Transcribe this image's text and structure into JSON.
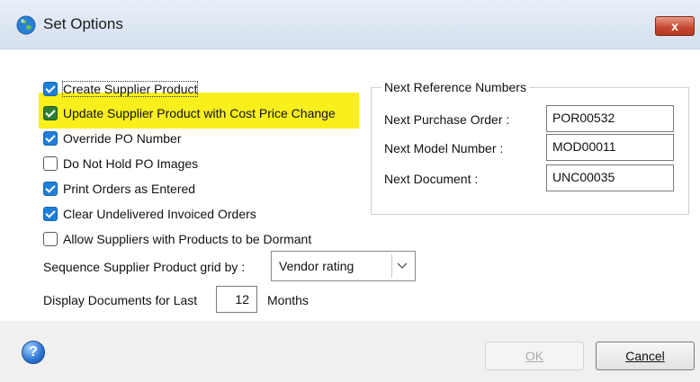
{
  "window": {
    "title": "Set Options",
    "close_label": "x"
  },
  "options": [
    {
      "label": "Create Supplier Product",
      "checked": true
    },
    {
      "label": "Update Supplier Product with Cost Price Change",
      "checked": true
    },
    {
      "label": "Override PO Number",
      "checked": true
    },
    {
      "label": "Do Not Hold PO Images",
      "checked": false
    },
    {
      "label": "Print Orders as Entered",
      "checked": true
    },
    {
      "label": "Clear Undelivered Invoiced Orders",
      "checked": true
    },
    {
      "label": "Allow Suppliers with Products to be Dormant",
      "checked": false
    }
  ],
  "reference": {
    "group_title": "Next Reference Numbers",
    "rows": [
      {
        "label": "Next Purchase Order :",
        "value": "POR00532"
      },
      {
        "label": "Next Model Number :",
        "value": "MOD00011"
      },
      {
        "label": "Next Document :",
        "value": "UNC00035"
      }
    ]
  },
  "sequence": {
    "label": "Sequence Supplier Product grid by :",
    "selected": "Vendor rating"
  },
  "display": {
    "label": "Display Documents for Last",
    "value": "12",
    "unit": "Months"
  },
  "footer": {
    "help_label": "?",
    "ok_label": "OK",
    "cancel_label": "Cancel"
  },
  "colors": {
    "highlight": "#f9ef1b",
    "checkbox_checked": "#1f7fd8",
    "close_button": "#c5462e"
  }
}
